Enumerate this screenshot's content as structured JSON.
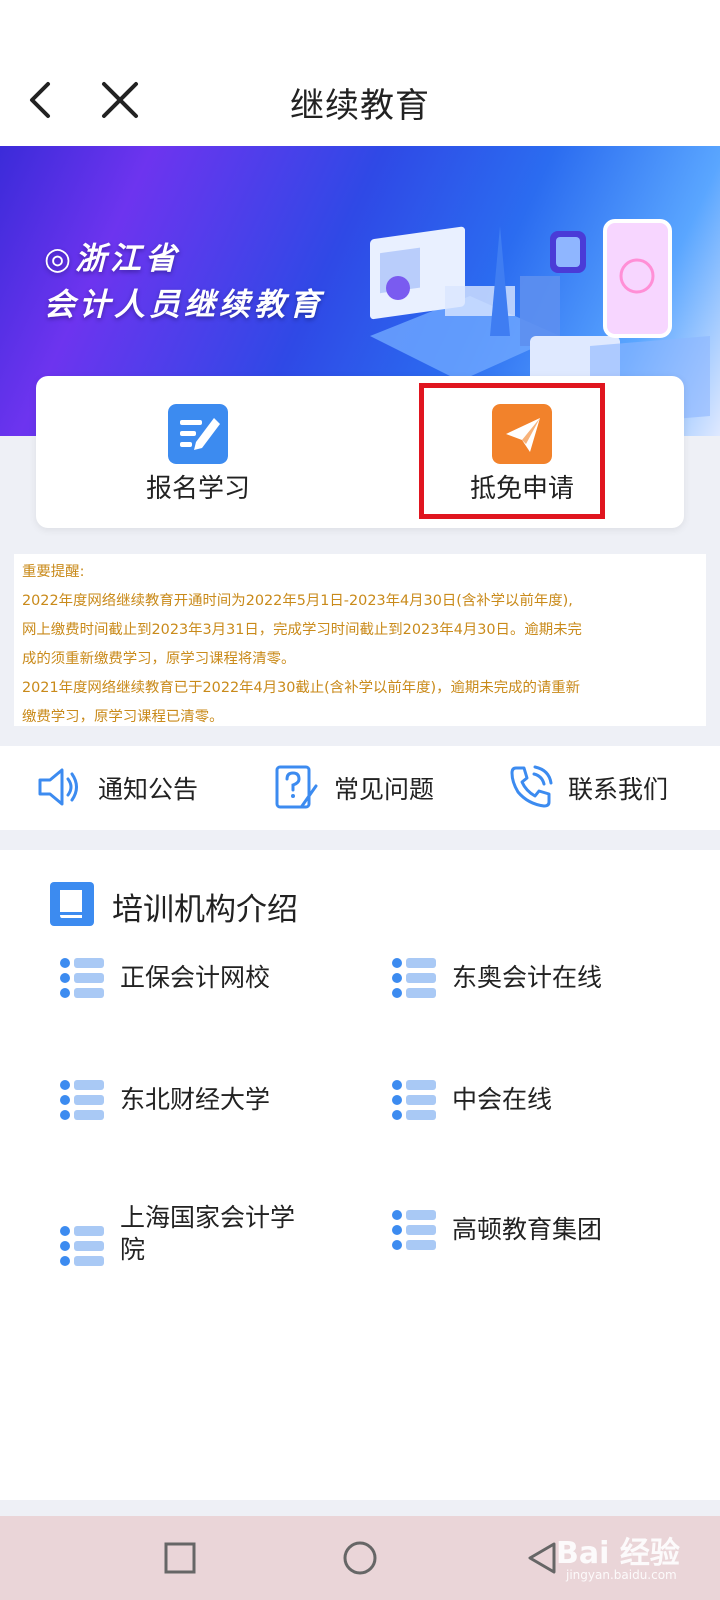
{
  "header": {
    "title": "继续教育",
    "back_icon": "chevron-left-icon",
    "close_icon": "close-icon"
  },
  "banner": {
    "title_line1": "浙江省",
    "title_line2": "会计人员继续教育"
  },
  "actions": [
    {
      "label": "报名学习",
      "icon": "edit-document-icon",
      "color": "#3c8bf0"
    },
    {
      "label": "抵免申请",
      "icon": "paper-plane-icon",
      "color": "#f2822b"
    }
  ],
  "notice": {
    "heading": "重要提醒:",
    "lines": [
      "2022年度网络继续教育开通时间为2022年5月1日-2023年4月30日(含补学以前年度),",
      "网上缴费时间截止到2023年3月31日，完成学习时间截止到2023年4月30日。逾期未完",
      "成的须重新缴费学习，原学习课程将清零。",
      "2021年度网络继续教育已于2022年4月30截止(含补学以前年度)，逾期未完成的请重新",
      "缴费学习，原学习课程已清零。"
    ],
    "color": "#c98a1a"
  },
  "quick_links": [
    {
      "label": "通知公告",
      "icon": "speaker-icon"
    },
    {
      "label": "常见问题",
      "icon": "question-doc-icon"
    },
    {
      "label": "联系我们",
      "icon": "phone-icon"
    }
  ],
  "training": {
    "title": "培训机构介绍",
    "icon": "book-icon",
    "orgs": [
      "正保会计网校",
      "东奥会计在线",
      "东北财经大学",
      "中会在线",
      "上海国家会计学院",
      "高顿教育集团"
    ]
  },
  "navbar": {
    "icons": [
      "square-icon",
      "circle-icon",
      "triangle-back-icon"
    ],
    "watermark": "Bai 经验",
    "watermark_sub": "jingyan.baidu.com"
  }
}
